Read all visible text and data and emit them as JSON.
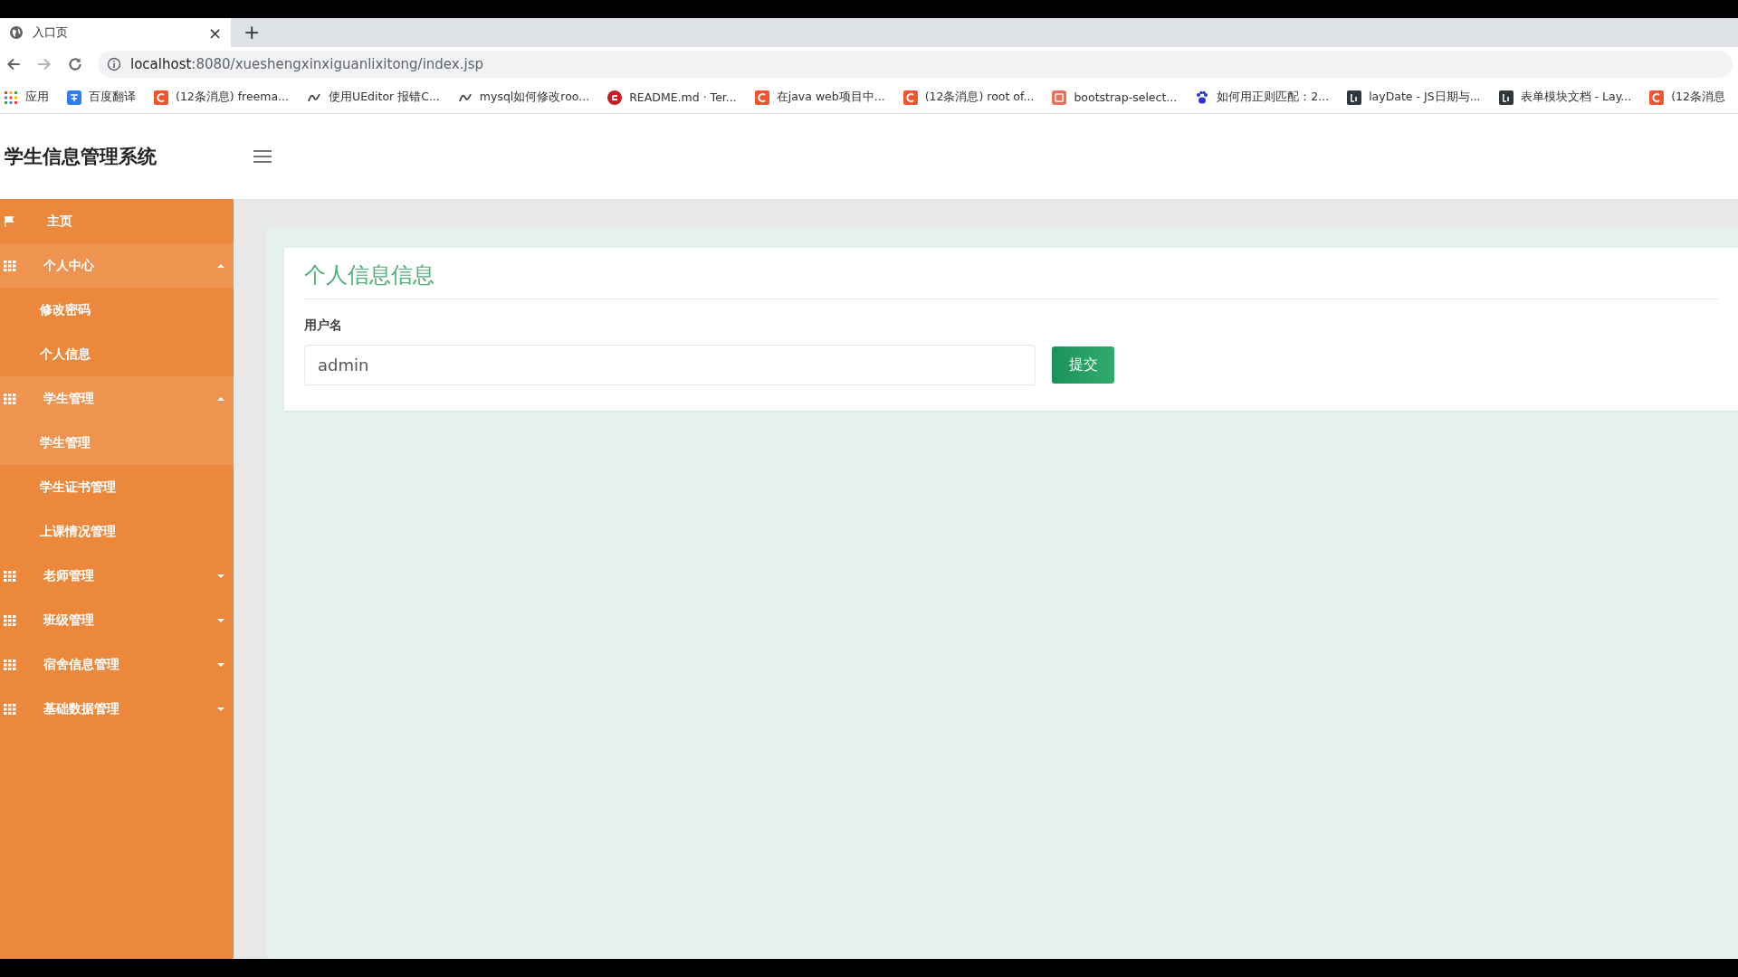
{
  "browser": {
    "tab": {
      "title": "入口页",
      "close": "×"
    },
    "new_tab": "+",
    "url": {
      "host": "localhost",
      "rest": ":8080/xueshengxinxiguanlixitong/index.jsp"
    },
    "bookmarks": [
      {
        "kind": "apps",
        "label": "应用"
      },
      {
        "kind": "translate",
        "label": "百度翻译"
      },
      {
        "kind": "c",
        "label": "(12条消息) freema..."
      },
      {
        "kind": "script",
        "label": "使用UEditor 报错C..."
      },
      {
        "kind": "script",
        "label": "mysql如何修改roo..."
      },
      {
        "kind": "gitee",
        "label": "README.md · Ter..."
      },
      {
        "kind": "c",
        "label": "在java web项目中..."
      },
      {
        "kind": "c",
        "label": "(12条消息) root of..."
      },
      {
        "kind": "jian",
        "label": "bootstrap-select..."
      },
      {
        "kind": "paw",
        "label": "如何用正则匹配：2..."
      },
      {
        "kind": "layui",
        "label": "layDate - JS日期与..."
      },
      {
        "kind": "layui",
        "label": "表单模块文档 - Lay..."
      },
      {
        "kind": "c",
        "label": "(12条消息"
      }
    ]
  },
  "app": {
    "title": "学生信息管理系统"
  },
  "sidebar": [
    {
      "kind": "link",
      "label": "主页"
    },
    {
      "kind": "group",
      "label": "个人中心",
      "expanded": true,
      "children": [
        {
          "label": "修改密码",
          "selected": false
        },
        {
          "label": "个人信息",
          "selected": false
        }
      ]
    },
    {
      "kind": "group",
      "label": "学生管理",
      "expanded": true,
      "children": [
        {
          "label": "学生管理",
          "selected": true
        },
        {
          "label": "学生证书管理",
          "selected": false
        },
        {
          "label": "上课情况管理",
          "selected": false
        }
      ]
    },
    {
      "kind": "group",
      "label": "老师管理",
      "expanded": false
    },
    {
      "kind": "group",
      "label": "班级管理",
      "expanded": false
    },
    {
      "kind": "group",
      "label": "宿舍信息管理",
      "expanded": false
    },
    {
      "kind": "group",
      "label": "基础数据管理",
      "expanded": false
    }
  ],
  "form": {
    "title": "个人信息信息",
    "field_label": "用户名",
    "value": "admin",
    "submit": "提交"
  }
}
